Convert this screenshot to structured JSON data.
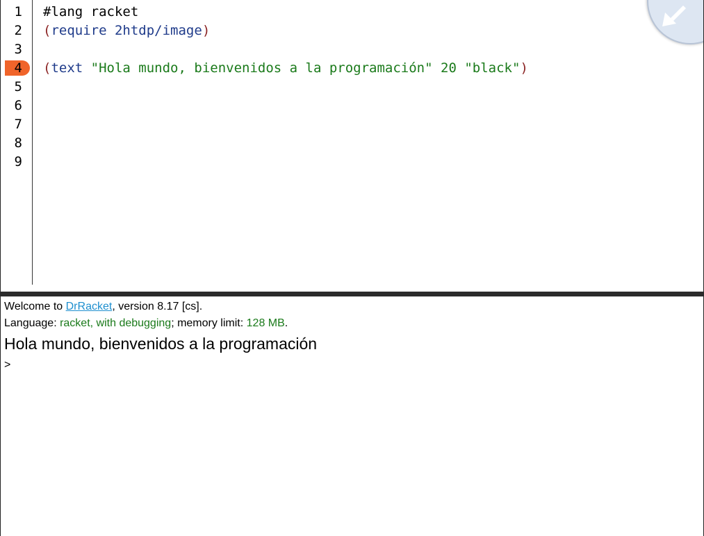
{
  "editor": {
    "line_numbers": [
      "1",
      "2",
      "3",
      "4",
      "5",
      "6",
      "7",
      "8",
      "9"
    ],
    "breakpoint_line": "4",
    "line1": {
      "hashlang": "#lang racket"
    },
    "line2": {
      "open": "(",
      "keyword": "require",
      "space": " ",
      "module": "2htdp/image",
      "close": ")"
    },
    "line4": {
      "open": "(",
      "func": "text",
      "sp1": " ",
      "string": "\"Hola mundo, bienvenidos a la programación\"",
      "sp2": " ",
      "size": "20",
      "sp3": " ",
      "color": "\"black\"",
      "close": ")"
    },
    "corner_icon": "arrow-down-left-icon"
  },
  "interactions": {
    "welcome_prefix": "Welcome to ",
    "welcome_link": "DrRacket",
    "welcome_suffix": ", version 8.17 [cs].",
    "language_prefix": "Language: ",
    "language_value": "racket, with debugging",
    "memory_prefix": "; memory limit: ",
    "memory_value": "128 MB",
    "memory_suffix": ".",
    "output": "Hola mundo, bienvenidos a la programación",
    "prompt": ">"
  },
  "colors": {
    "breakpoint": "#f0642a",
    "string": "#1a7a1a",
    "paren": "#8b2323",
    "keyword": "#1f3b8a",
    "link": "#1e8fcf"
  }
}
